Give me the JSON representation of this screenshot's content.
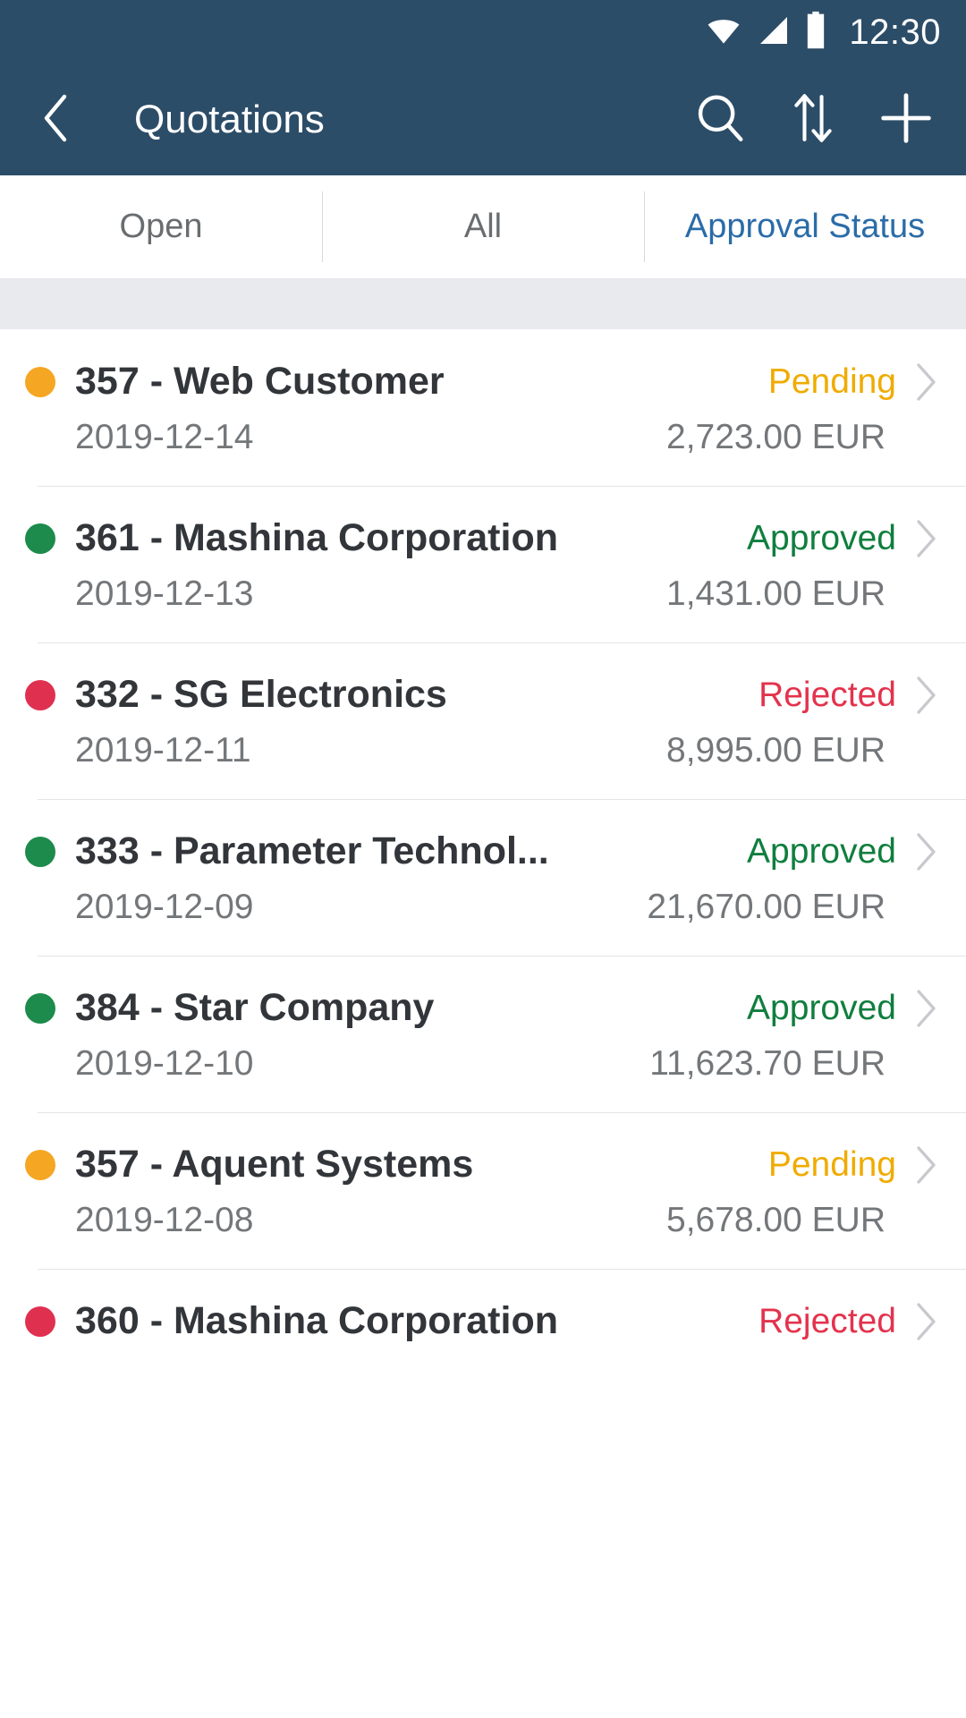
{
  "status_bar": {
    "time": "12:30",
    "icons": [
      "wifi-icon",
      "cellular-signal-icon",
      "battery-icon"
    ]
  },
  "header": {
    "title": "Quotations",
    "back_icon": "back-chevron-icon",
    "actions": [
      {
        "name": "search-icon",
        "label": "Search"
      },
      {
        "name": "sort-icon",
        "label": "Sort"
      },
      {
        "name": "add-icon",
        "label": "Create"
      }
    ],
    "background_color": "#2c4d68"
  },
  "tabs": [
    {
      "label": "Open",
      "active": false
    },
    {
      "label": "All",
      "active": false
    },
    {
      "label": "Approval Status",
      "active": true
    }
  ],
  "colors": {
    "accent_blue": "#2b6ca8",
    "pending": "#f0ab00",
    "approved": "#107e3e",
    "rejected": "#e3334d",
    "text_primary": "#32363a",
    "text_secondary": "#74777a"
  },
  "list": {
    "rows": [
      {
        "title": "357 - Web Customer",
        "date": "2019-12-14",
        "amount": "2,723.00 EUR",
        "status": "Pending",
        "status_color": "#f0ab00",
        "dot_color": "#f5a623"
      },
      {
        "title": "361 - Mashina Corporation",
        "date": "2019-12-13",
        "amount": "1,431.00 EUR",
        "status": "Approved",
        "status_color": "#107e3e",
        "dot_color": "#1c8b4b"
      },
      {
        "title": "332 - SG Electronics",
        "date": "2019-12-11",
        "amount": "8,995.00 EUR",
        "status": "Rejected",
        "status_color": "#e3334d",
        "dot_color": "#e03050"
      },
      {
        "title": "333 - Parameter Technol...",
        "date": "2019-12-09",
        "amount": "21,670.00 EUR",
        "status": "Approved",
        "status_color": "#107e3e",
        "dot_color": "#1c8b4b"
      },
      {
        "title": "384 - Star Company",
        "date": "2019-12-10",
        "amount": "11,623.70 EUR",
        "status": "Approved",
        "status_color": "#107e3e",
        "dot_color": "#1c8b4b"
      },
      {
        "title": "357 - Aquent Systems",
        "date": "2019-12-08",
        "amount": "5,678.00 EUR",
        "status": "Pending",
        "status_color": "#f0ab00",
        "dot_color": "#f5a623"
      },
      {
        "title": "360 - Mashina Corporation",
        "date": "",
        "amount": "",
        "status": "Rejected",
        "status_color": "#e3334d",
        "dot_color": "#e03050"
      }
    ]
  }
}
